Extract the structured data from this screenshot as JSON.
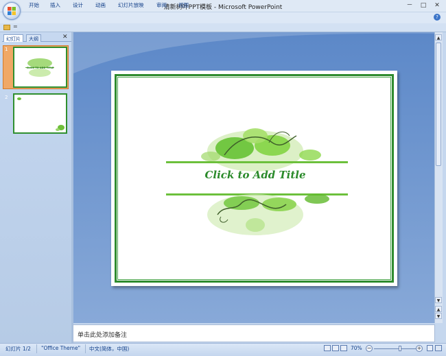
{
  "window": {
    "title": "清新树叶PPT模板 - Microsoft PowerPoint",
    "minimize": "－",
    "maximize": "□",
    "close": "✕"
  },
  "ribbon": {
    "tabs": [
      "开始",
      "插入",
      "设计",
      "动画",
      "幻灯片放映",
      "审阅",
      "视图"
    ],
    "help": "?"
  },
  "qat": {
    "more": "="
  },
  "panel": {
    "tabs": [
      "幻灯片",
      "大纲"
    ],
    "close": "✕"
  },
  "slides": [
    {
      "number": "1",
      "title": "CLICK TO ADD TITLE"
    },
    {
      "number": "2"
    }
  ],
  "slide": {
    "title": "Click to Add Title",
    "accent": "#2e8b2e"
  },
  "notes": {
    "placeholder": "单击此处添加备注"
  },
  "status": {
    "slide_pos": "幻灯片 1/2",
    "theme": "\"Office Theme\"",
    "language": "中文(简体，中国)",
    "zoom": "70%"
  },
  "scroll": {
    "up": "▲",
    "down": "▼",
    "prev": "▲",
    "next": "▼"
  },
  "zoom": {
    "level_percent": 70,
    "minus": "−",
    "plus": "+"
  }
}
